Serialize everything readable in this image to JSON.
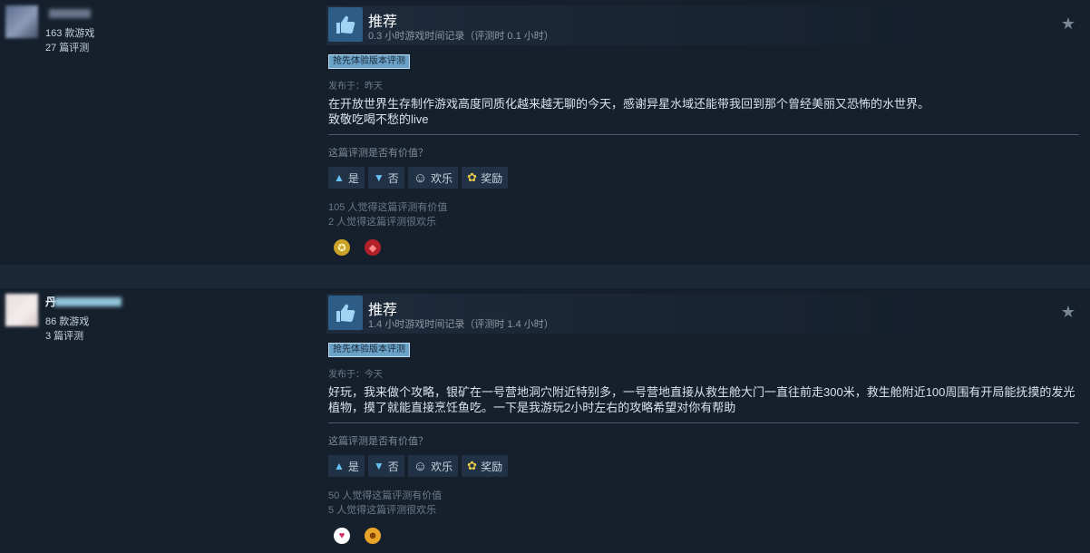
{
  "reviews": [
    {
      "author": {
        "initial": "",
        "games": "163 款游戏",
        "reviews": "27 篇评测"
      },
      "verdict": "推荐",
      "hours": "0.3 小时游戏时间记录（评测时 0.1 小时）",
      "early_access": "抢先体验版本评测",
      "posted": "发布于：昨天",
      "content": [
        "在开放世界生存制作游戏高度同质化越来越无聊的今天，感谢异星水域还能带我回到那个曾经美丽又恐怖的水世界。",
        "致敬吃喝不愁的live"
      ],
      "helpful_question": "这篇评测是否有价值？",
      "buttons": {
        "yes": "是",
        "no": "否",
        "funny": "欢乐",
        "award": "奖励"
      },
      "helpful_count": "105 人觉得这篇评测有价值",
      "funny_count": "2 人觉得这篇评测很欢乐",
      "awards": [
        "gold-medal",
        "red-gem"
      ]
    },
    {
      "author": {
        "initial": "丹",
        "games": "86 款游戏",
        "reviews": "3 篇评测"
      },
      "verdict": "推荐",
      "hours": "1.4 小时游戏时间记录（评测时 1.4 小时）",
      "early_access": "抢先体验版本评测",
      "posted": "发布于：今天",
      "content": [
        "好玩，我来做个攻略，银矿在一号营地洞穴附近特别多，一号营地直接从救生舱大门一直往前走300米，救生舱附近100周围有开局能抚摸的发光植物，摸了就能直接烹饪鱼吃。一下是我游玩2小时左右的攻略希望对你有帮助"
      ],
      "helpful_question": "这篇评测是否有价值？",
      "buttons": {
        "yes": "是",
        "no": "否",
        "funny": "欢乐",
        "award": "奖励"
      },
      "helpful_count": "50 人觉得这篇评测有价值",
      "funny_count": "5 人觉得这篇评测很欢乐",
      "awards": [
        "heart-award",
        "smile-award"
      ]
    }
  ],
  "icons": {
    "thumbs_up": "thumbs-up-icon",
    "star": "star-icon",
    "yes": "thumb-small-up-icon",
    "no": "thumb-small-down-icon",
    "funny": "smiley-icon",
    "award": "award-ribbon-icon"
  },
  "colors": {
    "background": "#1b2838",
    "card": "#16202d",
    "accent": "#67c1f5",
    "thumb_box": "#2d5c86",
    "early_access_tag": "#6aa2c8"
  }
}
